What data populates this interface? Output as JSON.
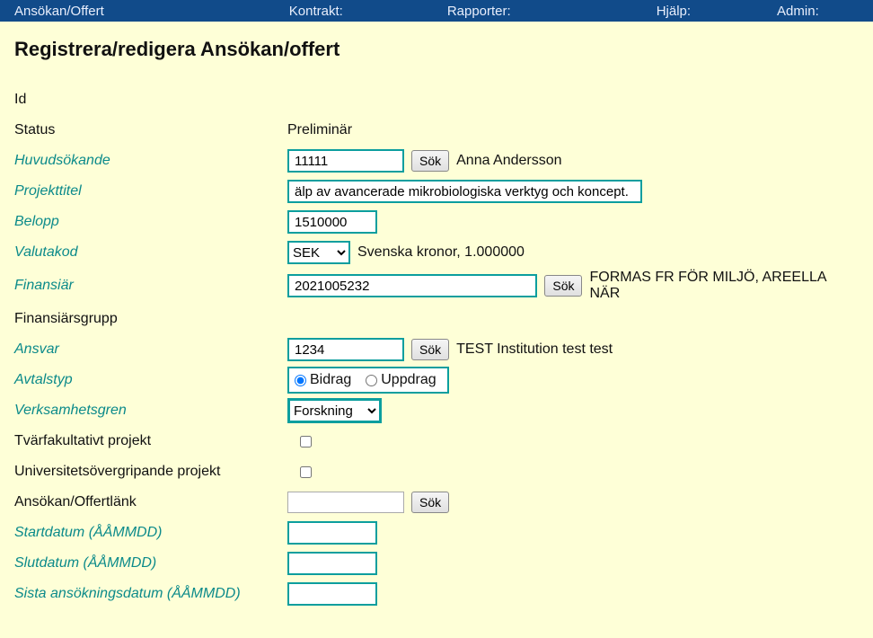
{
  "nav": {
    "item1": "Ansökan/Offert",
    "item2": "Kontrakt:",
    "item3": "Rapporter:",
    "item4": "Hjälp:",
    "item5": "Admin:"
  },
  "page": {
    "title": "Registrera/redigera Ansökan/offert"
  },
  "labels": {
    "id": "Id",
    "status": "Status",
    "huvudsokande": "Huvudsökande",
    "projekttitel": "Projekttitel",
    "belopp": "Belopp",
    "valutakod": "Valutakod",
    "finansiar": "Finansiär",
    "finansiarsgrupp": "Finansiärsgrupp",
    "ansvar": "Ansvar",
    "avtalstyp": "Avtalstyp",
    "verksamhetsgren": "Verksamhetsgren",
    "tvar": "Tvärfakultativt projekt",
    "univ": "Universitetsövergripande projekt",
    "ansokanlank": "Ansökan/Offertlänk",
    "startdatum": "Startdatum (ÅÅMMDD)",
    "slutdatum": "Slutdatum (ÅÅMMDD)",
    "sistaansokan": "Sista ansökningsdatum (ÅÅMMDD)"
  },
  "values": {
    "status": "Preliminär",
    "huvudsokande": "11111",
    "huvudsokande_name": "Anna Andersson",
    "projekttitel": "älp av avancerade mikrobiologiska verktyg och koncept.",
    "belopp": "1510000",
    "valutakod_selected": "SEK",
    "valutakod_desc": "Svenska kronor, 1.000000",
    "finansiar": "2021005232",
    "finansiar_desc": "FORMAS FR FÖR MILJÖ, AREELLA NÄR",
    "ansvar": "1234",
    "ansvar_desc": "TEST Institution test test",
    "verksamhetsgren_selected": "Forskning",
    "ansokanlank": "",
    "startdatum": "",
    "slutdatum": "",
    "sistaansokan": ""
  },
  "buttons": {
    "sok": "Sök"
  },
  "radios": {
    "bidrag": "Bidrag",
    "uppdrag": "Uppdrag"
  }
}
